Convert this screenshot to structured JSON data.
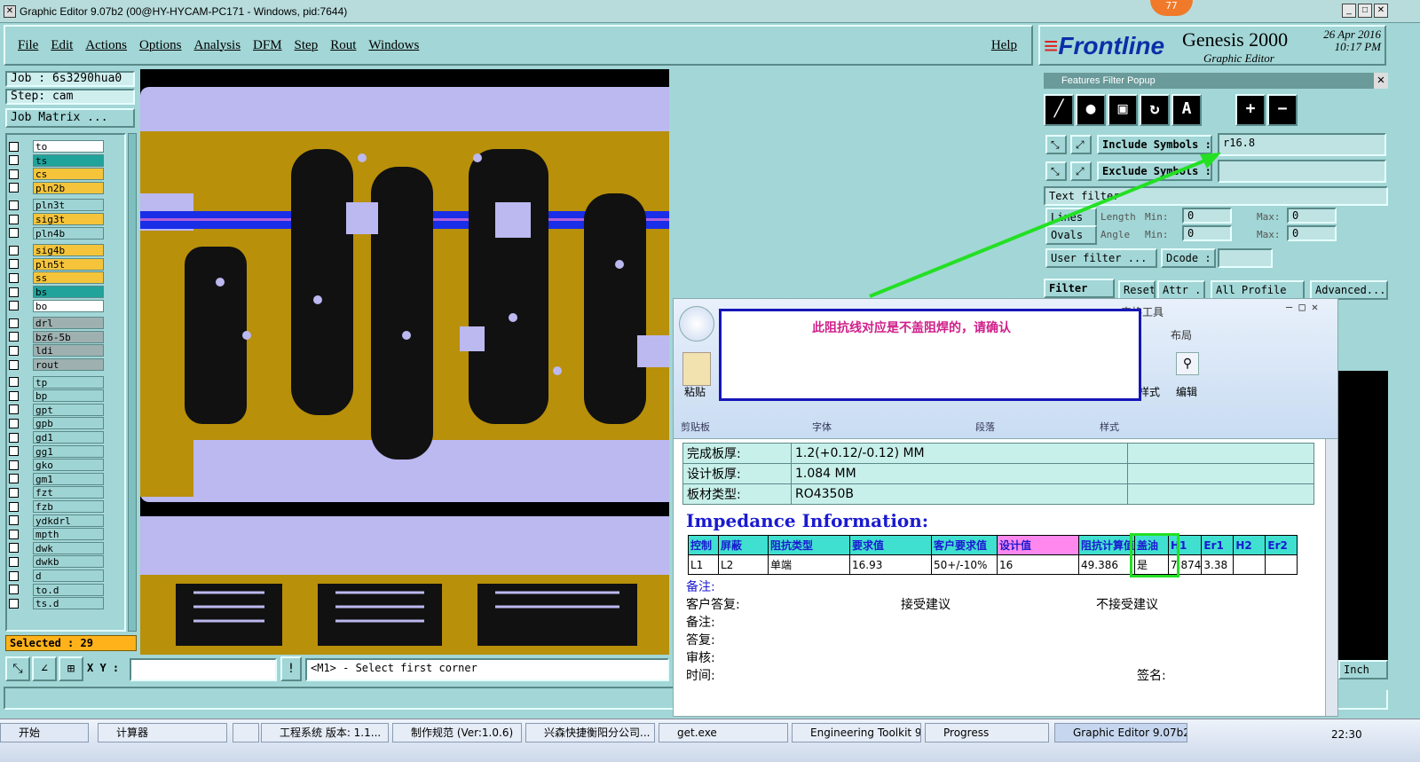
{
  "window": {
    "title": "Graphic Editor 9.07b2 (00@HY-HYCAM-PC171 - Windows, pid:7644)",
    "badge": "77"
  },
  "menu": {
    "items": [
      "File",
      "Edit",
      "Actions",
      "Options",
      "Analysis",
      "DFM",
      "Step",
      "Rout",
      "Windows"
    ],
    "help": "Help"
  },
  "brand": {
    "frontline": "Frontline",
    "product": "Genesis 2000",
    "editor": "Graphic Editor",
    "date": "26 Apr 2016",
    "time": "10:17 PM"
  },
  "job": {
    "job": "Job : 6s3290hua0",
    "step": "Step: cam",
    "matrix": "Job Matrix ..."
  },
  "layers": [
    {
      "name": "to",
      "color": "#ffffff"
    },
    {
      "name": "ts",
      "color": "#1fa39b"
    },
    {
      "name": "cs",
      "color": "#f5c43a"
    },
    {
      "name": "pln2b",
      "color": "#f5c43a"
    },
    {
      "name": "pln3t",
      "color": "#9fd4d4"
    },
    {
      "name": "sig3t",
      "color": "#f5c43a"
    },
    {
      "name": "pln4b",
      "color": "#9fd4d4"
    },
    {
      "name": "sig4b",
      "color": "#f5c43a"
    },
    {
      "name": "pln5t",
      "color": "#f5c43a"
    },
    {
      "name": "ss",
      "color": "#f5c43a"
    },
    {
      "name": "bs",
      "color": "#1fa39b"
    },
    {
      "name": "bo",
      "color": "#ffffff"
    },
    {
      "name": "drl",
      "color": "#9fb0b0"
    },
    {
      "name": "bz6-5b",
      "color": "#9fb0b0"
    },
    {
      "name": "ldi",
      "color": "#9fb0b0"
    },
    {
      "name": "rout",
      "color": "#9fb0b0"
    },
    {
      "name": "tp",
      "color": "#9fd4d4"
    },
    {
      "name": "bp",
      "color": "#9fd4d4"
    },
    {
      "name": "gpt",
      "color": "#9fd4d4"
    },
    {
      "name": "gpb",
      "color": "#9fd4d4"
    },
    {
      "name": "gd1",
      "color": "#9fd4d4"
    },
    {
      "name": "gg1",
      "color": "#9fd4d4"
    },
    {
      "name": "gko",
      "color": "#9fd4d4"
    },
    {
      "name": "gm1",
      "color": "#9fd4d4"
    },
    {
      "name": "fzt",
      "color": "#9fd4d4"
    },
    {
      "name": "fzb",
      "color": "#9fd4d4"
    },
    {
      "name": "ydkdrl",
      "color": "#9fd4d4"
    },
    {
      "name": "mpth",
      "color": "#9fd4d4"
    },
    {
      "name": "dwk",
      "color": "#9fd4d4"
    },
    {
      "name": "dwkb",
      "color": "#9fd4d4"
    },
    {
      "name": "d",
      "color": "#9fd4d4"
    },
    {
      "name": "to.d",
      "color": "#9fd4d4"
    },
    {
      "name": "ts.d",
      "color": "#9fd4d4"
    }
  ],
  "selected": "Selected : 29",
  "coords": {
    "label": "X Y :",
    "prompt": "<M1> - Select first corner"
  },
  "filter": {
    "title": "Features Filter Popup",
    "include_label": "Include Symbols :",
    "include_value": "r16.8",
    "exclude_label": "Exclude Symbols :",
    "text_filter": "Text filter",
    "lines": "Lines",
    "ovals": "Ovals",
    "length": "Length",
    "angle": "Angle",
    "min": "Min:",
    "max": "Max:",
    "zero": "0",
    "user_filter": "User filter ...",
    "dcode": "Dcode :",
    "filter_btn": "Filter",
    "reset": "Reset",
    "attr": "Attr ...",
    "all_profile": "All Profile",
    "advanced": "Advanced...",
    "inch": "Inch"
  },
  "callout": "此阻抗线对应是不盖阻焊的，请确认",
  "word": {
    "tab_tools": "表格工具",
    "tab_design": "计",
    "tab_layout": "布局",
    "paste": "粘贴",
    "clipboard": "剪贴板",
    "font": "字体",
    "paragraph": "段落",
    "styles": "样式",
    "style_btn": "样式",
    "edit": "编辑",
    "rows": [
      {
        "k": "完成板厚:",
        "v": "1.2(+0.12/-0.12) MM"
      },
      {
        "k": "设计板厚:",
        "v": "1.084 MM"
      },
      {
        "k": "板材类型:",
        "v": "RO4350B"
      }
    ],
    "imp_title": "Impedance Information:",
    "headers": [
      "控制",
      "屏蔽",
      "阻抗类型",
      "要求值",
      "客户要求值",
      "设计值",
      "阻抗计算值",
      "盖油",
      "H1",
      "Er1",
      "H2",
      "Er2"
    ],
    "row": [
      "L1",
      "L2",
      "单端",
      "16.93",
      "50+/-10%",
      "16",
      "49.386",
      "是",
      "7.874",
      "3.38",
      "",
      ""
    ],
    "notes": {
      "n1": "备注:",
      "reply": "客户答复:",
      "accept": "接受建议",
      "reject": "不接受建议",
      "n2": "备注:",
      "ans": "答复:",
      "review": "审核:",
      "time": "时间:",
      "sign": "签名:"
    }
  },
  "taskbar": {
    "start": "开始",
    "items": [
      "计算器",
      "工程系统 版本: 1.1...",
      "制作规范 (Ver:1.0.6)",
      "兴森快捷衡阳分公司...",
      "get.exe",
      "Engineering Toolkit 9.0...",
      "Progress",
      "Graphic Editor 9.07b2 (..."
    ],
    "clock": "22:30"
  }
}
